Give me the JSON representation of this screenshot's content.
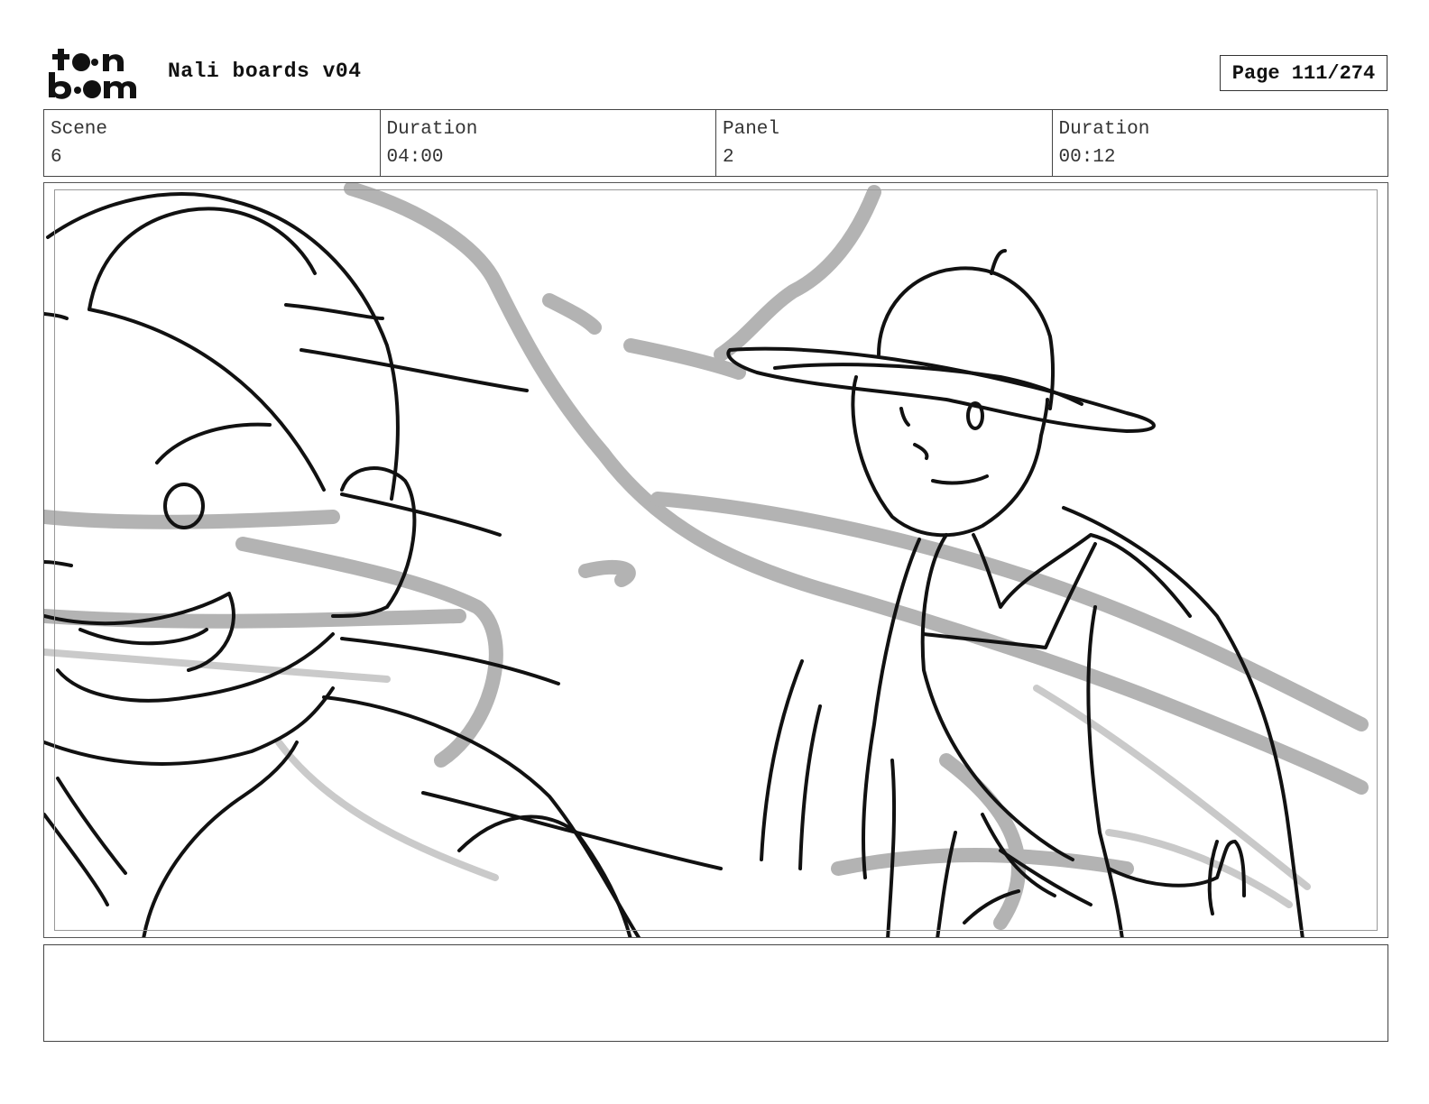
{
  "header": {
    "logo_text": "toon boom",
    "document_title": "Nali boards v04",
    "page_label": "Page 111/274"
  },
  "info": {
    "scene_label": "Scene",
    "scene_value": "6",
    "scene_duration_label": "Duration",
    "scene_duration_value": "04:00",
    "panel_label": "Panel",
    "panel_value": "2",
    "panel_duration_label": "Duration",
    "panel_duration_value": "00:12"
  },
  "notes": {
    "text": ""
  },
  "colors": {
    "ink": "#111111",
    "tone": "#9a9a9a",
    "frame": "#444444"
  }
}
